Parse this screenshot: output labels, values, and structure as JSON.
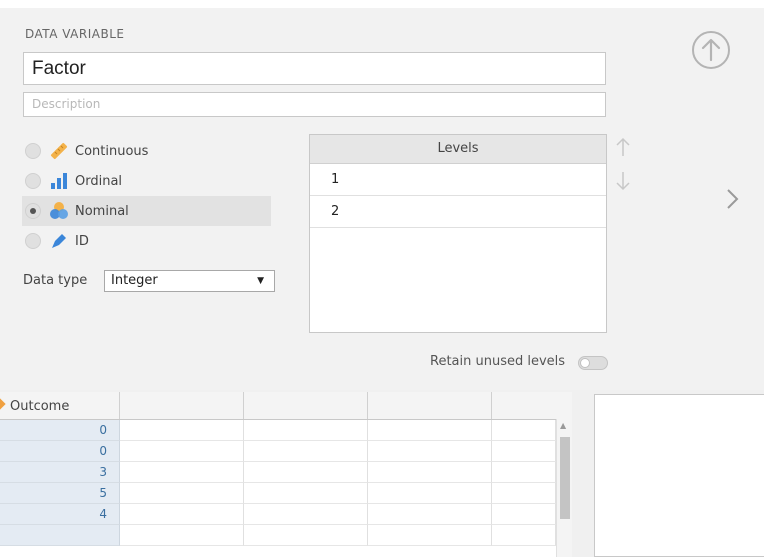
{
  "variable_editor": {
    "section_title": "DATA VARIABLE",
    "name_value": "Factor",
    "description_placeholder": "Description",
    "measure_types": [
      {
        "label": "Continuous",
        "selected": false,
        "icon": "ruler-icon"
      },
      {
        "label": "Ordinal",
        "selected": false,
        "icon": "bar-chart-icon"
      },
      {
        "label": "Nominal",
        "selected": true,
        "icon": "venn-circles-icon"
      },
      {
        "label": "ID",
        "selected": false,
        "icon": "tag-icon"
      }
    ],
    "data_type_label": "Data type",
    "data_type_value": "Integer",
    "levels_header": "Levels",
    "levels": [
      "1",
      "2"
    ],
    "retain_label": "Retain unused levels",
    "retain_on": false
  },
  "spreadsheet": {
    "column_name": "Outcome",
    "values": [
      "0",
      "0",
      "3",
      "5",
      "4"
    ]
  },
  "colors": {
    "accent_orange": "#f0a040",
    "nominal_blue": "#3b86d9",
    "row_number_blue": "#3a6fa0"
  }
}
